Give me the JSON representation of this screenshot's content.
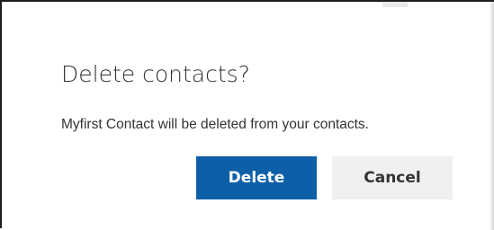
{
  "dialog": {
    "title": "Delete contacts?",
    "message": "Myfirst Contact will be deleted from your contacts.",
    "delete_label": "Delete",
    "cancel_label": "Cancel",
    "primary_color": "#0d60a8"
  }
}
